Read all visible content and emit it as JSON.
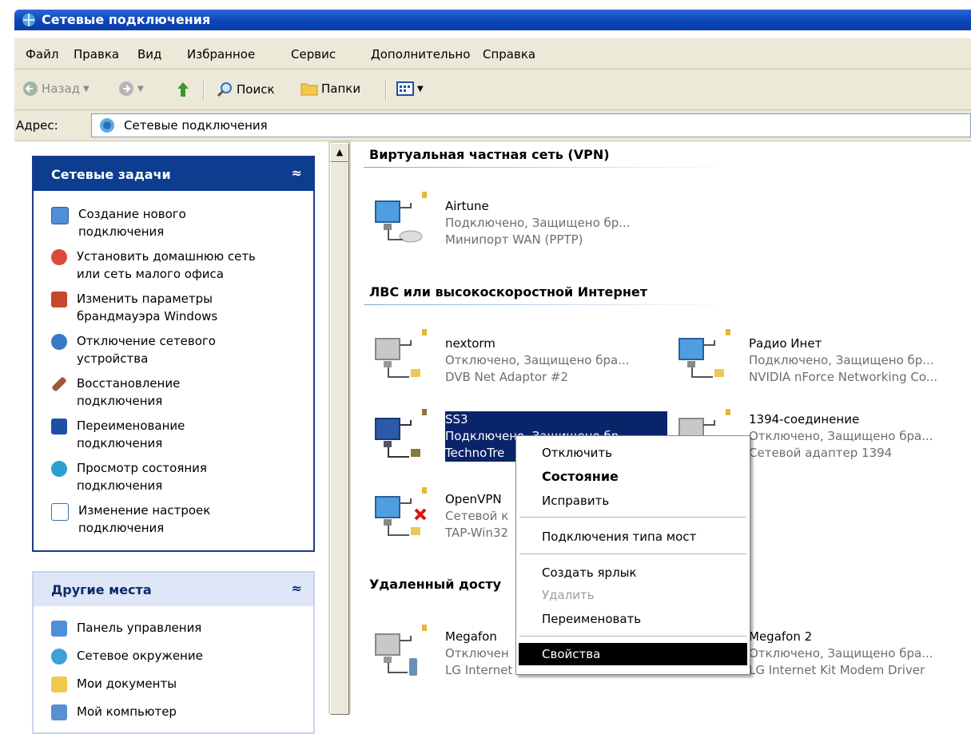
{
  "window": {
    "title": "Сетевые подключения"
  },
  "menu": [
    "Файл",
    "Правка",
    "Вид",
    "Избранное",
    "Сервис",
    "Дополнительно",
    "Справка"
  ],
  "toolbar": {
    "back": "Назад",
    "search": "Поиск",
    "folders": "Папки"
  },
  "address": {
    "label": "Адрес:",
    "value": "Сетевые подключения"
  },
  "network_tasks": {
    "title": "Сетевые задачи",
    "items": [
      [
        "Создание нового",
        "подключения"
      ],
      [
        "Установить домашнюю сеть",
        "или сеть малого офиса"
      ],
      [
        "Изменить параметры",
        "брандмауэра Windows"
      ],
      [
        "Отключение сетевого",
        "устройства"
      ],
      [
        "Восстановление",
        "подключения"
      ],
      [
        "Переименование",
        "подключения"
      ],
      [
        "Просмотр состояния",
        "подключения"
      ],
      [
        "Изменение настроек",
        "подключения"
      ]
    ]
  },
  "other_places": {
    "title": "Другие места",
    "items": [
      "Панель управления",
      "Сетевое окружение",
      "Мои документы",
      "Мой компьютер"
    ]
  },
  "groups": {
    "vpn": "Виртуальная частная сеть (VPN)",
    "lan": "ЛВС или высокоскоростной Интернет",
    "remote": "Удаленный досту"
  },
  "connections": {
    "airtune": {
      "name": "Airtune",
      "status": "Подключено, Защищено бр...",
      "device": "Минипорт WAN (PPTP)"
    },
    "nextorm": {
      "name": "nextorm",
      "status": "Отключено, Защищено бра...",
      "device": "DVB Net Adaptor #2"
    },
    "radio": {
      "name": "Радио Инет",
      "status": "Подключено, Защищено бр...",
      "device": "NVIDIA nForce Networking Co..."
    },
    "ss3": {
      "name": "SS3",
      "status": "Подключено, Защищено бр...",
      "device": "TechnoTre"
    },
    "c1394": {
      "name": "1394-соединение",
      "status": "Отключено, Защищено бра...",
      "device": "Сетевой адаптер 1394"
    },
    "openvpn": {
      "name": "OpenVPN",
      "status": "Сетевой к",
      "device": "TAP-Win32"
    },
    "megafon": {
      "name": "Megafon",
      "status": "Отключен",
      "device": "LG Internet Kit Modem Driver"
    },
    "megafon2": {
      "name": "Megafon 2",
      "status": "Отключено, Защищено бра...",
      "device": "LG Internet Kit Modem Driver"
    }
  },
  "context_menu": {
    "disconnect": "Отключить",
    "status": "Состояние",
    "repair": "Исправить",
    "bridge": "Подключения типа мост",
    "shortcut": "Создать ярлык",
    "delete": "Удалить",
    "rename": "Переименовать",
    "properties": "Свойства"
  },
  "colors": {
    "title_bar": "#0c45b8",
    "panel_header": "#0c3d8e",
    "selection": "#0a246a",
    "chrome": "#ece9d8"
  }
}
